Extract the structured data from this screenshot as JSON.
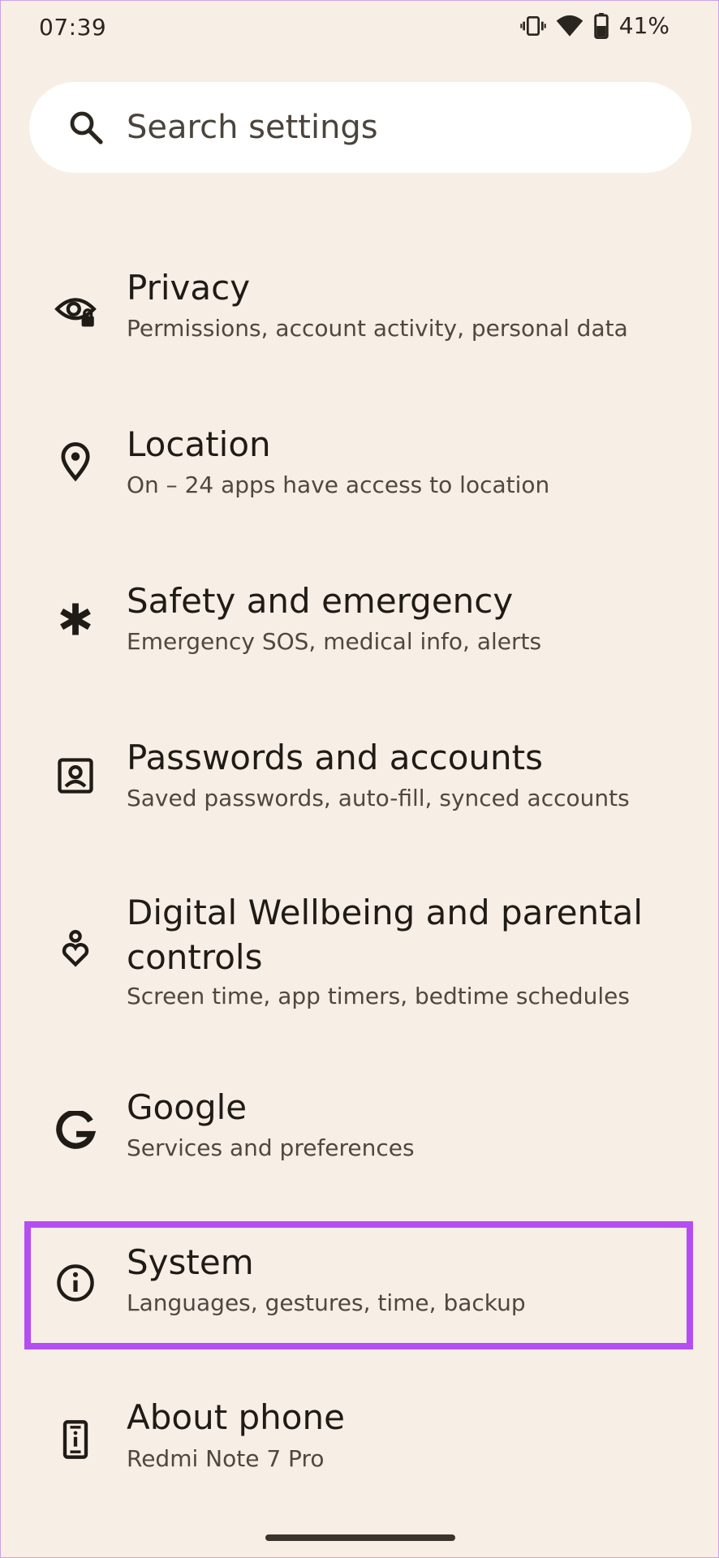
{
  "status_bar": {
    "time": "07:39",
    "battery": "41%",
    "icons": [
      "vibrate-icon",
      "wifi-icon",
      "battery-icon"
    ]
  },
  "search": {
    "placeholder": "Search settings",
    "icon": "search-icon"
  },
  "settings": [
    {
      "icon": "privacy-eye-lock-icon",
      "title": "Privacy",
      "subtitle": "Permissions, account activity, personal data"
    },
    {
      "icon": "location-pin-icon",
      "title": "Location",
      "subtitle": "On – 24 apps have access to location"
    },
    {
      "icon": "asterisk-icon",
      "title": "Safety and emergency",
      "subtitle": "Emergency SOS, medical info, alerts"
    },
    {
      "icon": "account-box-icon",
      "title": "Passwords and accounts",
      "subtitle": "Saved passwords, auto-fill, synced accounts"
    },
    {
      "icon": "wellbeing-heart-icon",
      "title": "Digital Wellbeing and parental controls",
      "subtitle": "Screen time, app timers, bedtime schedules"
    },
    {
      "icon": "google-g-icon",
      "title": "Google",
      "subtitle": "Services and preferences"
    },
    {
      "icon": "info-icon",
      "title": "System",
      "subtitle": "Languages, gestures, time, backup"
    },
    {
      "icon": "phone-info-icon",
      "title": "About phone",
      "subtitle": "Redmi Note 7 Pro"
    }
  ],
  "highlight_color": "#b44df2",
  "background_color": "#f7eee5"
}
